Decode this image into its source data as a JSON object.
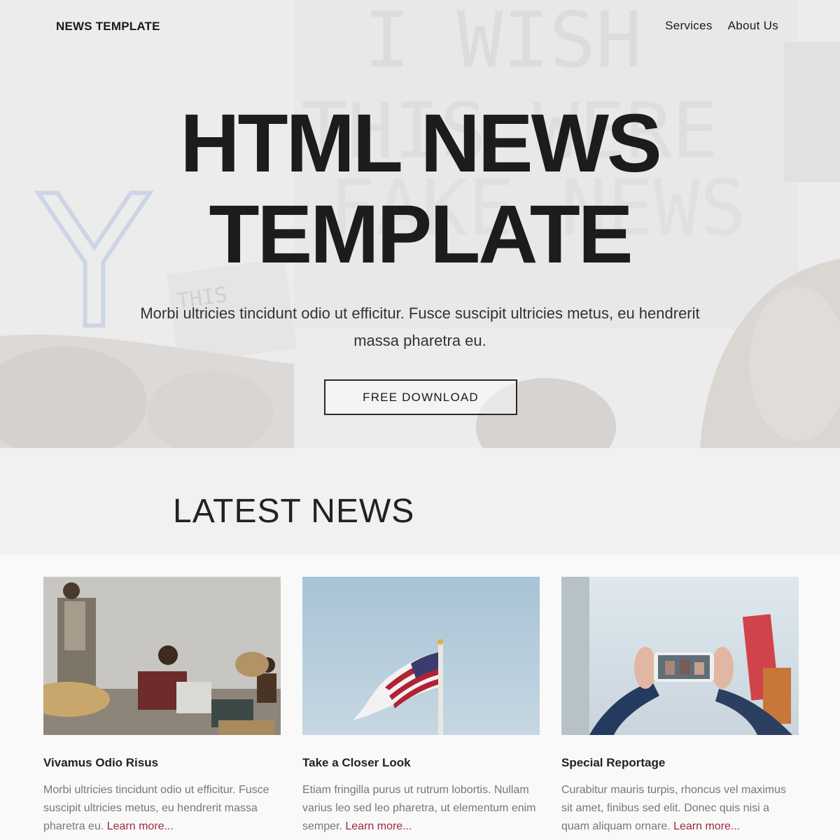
{
  "header": {
    "brand": "NEWS TEMPLATE",
    "nav": [
      {
        "label": "Services"
      },
      {
        "label": "About Us"
      }
    ]
  },
  "hero": {
    "title_line1": "HTML NEWS",
    "title_line2": "TEMPLATE",
    "subtitle": "Morbi ultricies tincidunt odio ut efficitur. Fusce suscipit ultricies metus, eu hendrerit massa pharetra eu.",
    "cta_label": "FREE DOWNLOAD",
    "background_sign_text": "I WISH THIS WERE FAKE NEWS"
  },
  "latest": {
    "heading": "LATEST NEWS",
    "cards": [
      {
        "title": "Vivamus Odio Risus",
        "body": "Morbi ultricies tincidunt odio ut efficitur. Fusce suscipit ultricies metus, eu hendrerit massa pharetra eu.",
        "link": "Learn more..."
      },
      {
        "title": "Take a Closer Look",
        "body": "Etiam fringilla purus ut rutrum lobortis. Nullam varius leo sed leo pharetra, ut elementum enim semper.",
        "link": "Learn more..."
      },
      {
        "title": "Special Reportage",
        "body": "Curabitur mauris turpis, rhoncus vel maximus sit amet, finibus sed elit. Donec quis nisi a quam aliquam ornare.",
        "link": "Learn more..."
      }
    ]
  },
  "colors": {
    "text_dark": "#1c1c1c",
    "muted": "#777777",
    "link": "#9e2a3f"
  }
}
